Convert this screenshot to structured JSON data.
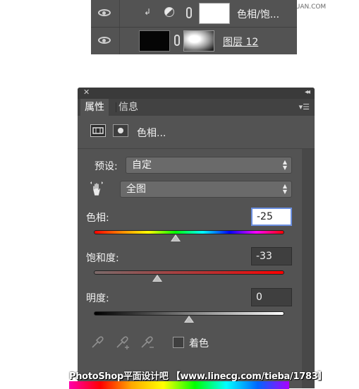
{
  "watermark_top": "思缘设计论坛 WWW.MISSYUAN.COM",
  "layers": {
    "rows": [
      {
        "name": "色相/饱...",
        "type": "adjustment"
      },
      {
        "name": "图层 12",
        "type": "masked"
      }
    ]
  },
  "panel": {
    "tabs": [
      {
        "label": "属性",
        "active": true
      },
      {
        "label": "信息",
        "active": false
      }
    ],
    "title": "色相...",
    "preset_label": "预设:",
    "preset_value": "自定",
    "range_value": "全图",
    "hue": {
      "label": "色相:",
      "value": "-25",
      "min": -180,
      "max": 180
    },
    "saturation": {
      "label": "饱和度:",
      "value": "-33",
      "min": -100,
      "max": 100
    },
    "lightness": {
      "label": "明度:",
      "value": "0",
      "min": -100,
      "max": 100
    },
    "colorize_label": "着色",
    "colorize_checked": false
  },
  "watermark_bottom": "PhotoShop平面设计吧 【www.linecg.com/tieba/1783】",
  "colors": {
    "panel_bg": "#535353",
    "focus_border": "#6b8fe0"
  }
}
